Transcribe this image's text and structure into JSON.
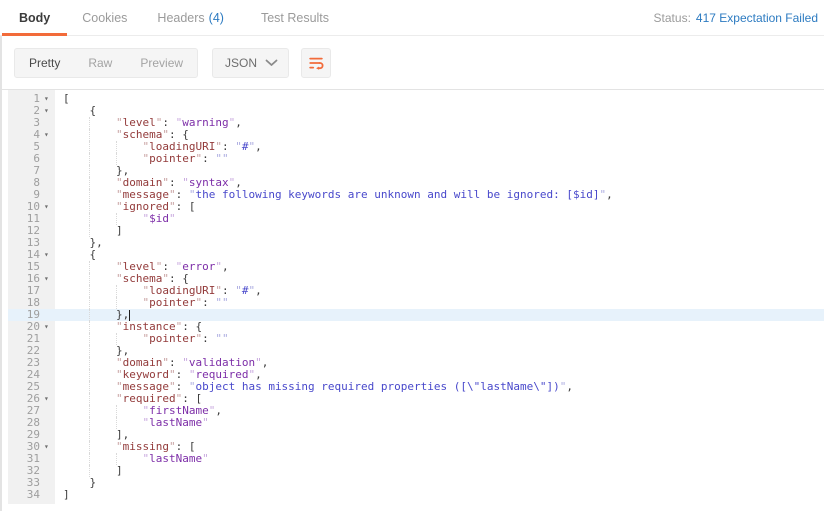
{
  "tabs": {
    "items": [
      {
        "label": "Body",
        "active": true
      },
      {
        "label": "Cookies",
        "active": false
      },
      {
        "label": "Headers",
        "count": "(4)",
        "active": false
      },
      {
        "label": "Test Results",
        "active": false
      }
    ]
  },
  "status": {
    "label": "Status:",
    "value": "417 Expectation Failed"
  },
  "toolbar": {
    "views": [
      "Pretty",
      "Raw",
      "Preview"
    ],
    "active_view": "Pretty",
    "format": "JSON",
    "icons": {
      "dropdown": "chevron-down-icon",
      "wrap": "wrap-lines-icon"
    }
  },
  "colors": {
    "accent_orange": "#F26B3A",
    "link_blue": "#2D7BC1",
    "active_line_bg": "#E7F2FB",
    "gutter_bg": "#F1F1F1",
    "token_key": "#933B3B",
    "token_string_word": "#7D2EA8",
    "token_string_text": "#4848CB",
    "token_punctuation": "#3B3B3B"
  },
  "editor": {
    "language": "JSON",
    "active_line": 19,
    "fold_glyph": "▾",
    "fold_lines": [
      1,
      2,
      4,
      10,
      14,
      16,
      20,
      26,
      30
    ],
    "lines": [
      "[",
      "    {",
      "        \"level\": \"warning\",",
      "        \"schema\": {",
      "            \"loadingURI\": \"#\",",
      "            \"pointer\": \"\"",
      "        },",
      "        \"domain\": \"syntax\",",
      "        \"message\": \"the following keywords are unknown and will be ignored: [$id]\",",
      "        \"ignored\": [",
      "            \"$id\"",
      "        ]",
      "    },",
      "    {",
      "        \"level\": \"error\",",
      "        \"schema\": {",
      "            \"loadingURI\": \"#\",",
      "            \"pointer\": \"\"",
      "        },",
      "        \"instance\": {",
      "            \"pointer\": \"\"",
      "        },",
      "        \"domain\": \"validation\",",
      "        \"keyword\": \"required\",",
      "        \"message\": \"object has missing required properties ([\\\"lastName\\\"])\",",
      "        \"required\": [",
      "            \"firstName\",",
      "            \"lastName\"",
      "        ],",
      "        \"missing\": [",
      "            \"lastName\"",
      "        ]",
      "    }",
      "]"
    ]
  }
}
